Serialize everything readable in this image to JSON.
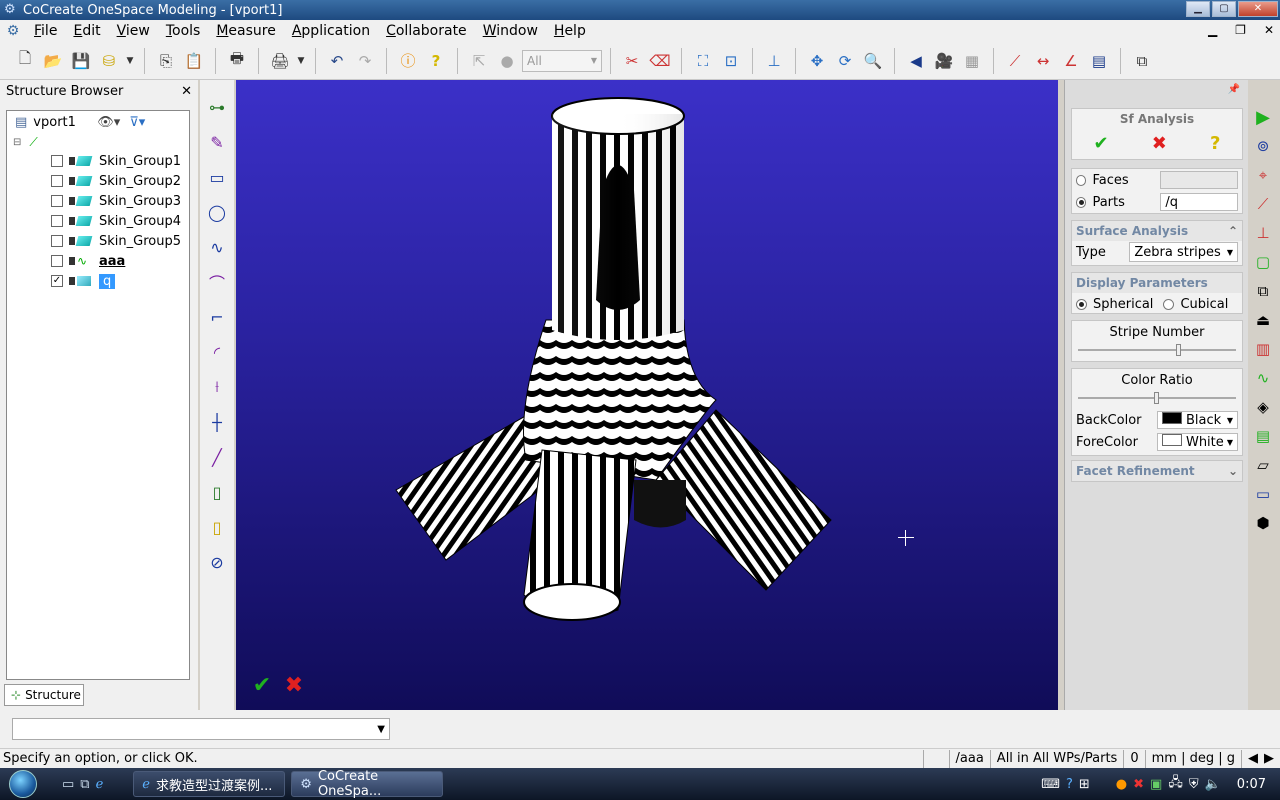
{
  "window": {
    "title": "CoCreate OneSpace Modeling - [vport1]"
  },
  "menu": [
    "File",
    "Edit",
    "View",
    "Tools",
    "Measure",
    "Application",
    "Collaborate",
    "Window",
    "Help"
  ],
  "toolbar": {
    "selector_value": "All"
  },
  "structure_browser": {
    "title": "Structure Browser",
    "viewport_name": "vport1",
    "tab_label": "Structure",
    "items": [
      {
        "label": "Skin_Group1",
        "checked": false,
        "type": "face-group"
      },
      {
        "label": "Skin_Group2",
        "checked": false,
        "type": "face-group"
      },
      {
        "label": "Skin_Group3",
        "checked": false,
        "type": "face-group"
      },
      {
        "label": "Skin_Group4",
        "checked": false,
        "type": "face-group"
      },
      {
        "label": "Skin_Group5",
        "checked": false,
        "type": "face-group"
      },
      {
        "label": "aaa",
        "checked": false,
        "type": "workplane-curve"
      },
      {
        "label": "q",
        "checked": true,
        "type": "part",
        "selected": true
      }
    ]
  },
  "dialog": {
    "title": "Sf Analysis",
    "faces_label": "Faces",
    "faces_value": "",
    "parts_label": "Parts",
    "parts_value": "/q",
    "surface_analysis_title": "Surface Analysis",
    "type_label": "Type",
    "type_value": "Zebra stripes",
    "display_params_title": "Display Parameters",
    "spherical_label": "Spherical",
    "cubical_label": "Cubical",
    "stripe_number_label": "Stripe Number",
    "stripe_number_level": 0.64,
    "color_ratio_label": "Color Ratio",
    "color_ratio_level": 0.5,
    "backcolor_label": "BackColor",
    "backcolor_value": "Black",
    "forecolor_label": "ForeColor",
    "forecolor_value": "White",
    "facet_refinement_title": "Facet Refinement"
  },
  "status": {
    "message": "Specify an option, or click OK.",
    "workplane": "/aaa",
    "scope": "All in All WPs/Parts",
    "count": "0",
    "units": "mm | deg | g"
  },
  "taskbar": {
    "tasks": [
      "求教造型过渡案例...",
      "CoCreate OneSpa..."
    ],
    "clock": "0:07"
  },
  "colors": {
    "viewport_top": "#3b30c8",
    "viewport_bottom": "#100c58",
    "ok_green": "#1fb11f",
    "cancel_red": "#e02020"
  }
}
